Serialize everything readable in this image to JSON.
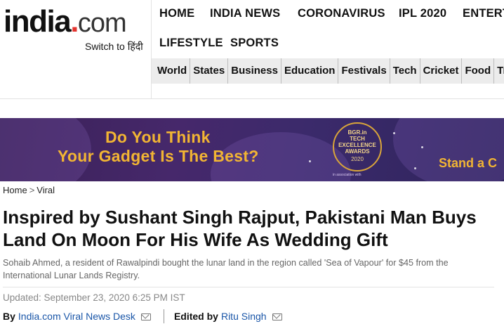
{
  "header": {
    "logo": {
      "main": "india",
      "dot": ".",
      "suffix": "com"
    },
    "switch_text": "Switch to हिंदी",
    "nav_row1": [
      "HOME",
      "INDIA NEWS",
      "CORONAVIRUS",
      "IPL 2020",
      "ENTERT"
    ],
    "nav_row2": [
      "LIFESTYLE",
      "SPORTS"
    ],
    "subnav": [
      "World",
      "States",
      "Business",
      "Education",
      "Festivals",
      "Tech",
      "Cricket",
      "Food",
      "Tra"
    ]
  },
  "banner": {
    "line1": "Do You Think",
    "line2": "Your Gadget Is The Best?",
    "badge": {
      "brand": "BGR.in",
      "line1": "TECH",
      "line2": "EXCELLENCE",
      "line3": "AWARDS",
      "year": "2020"
    },
    "association": "in association with",
    "cta": "Stand a C",
    "colors": {
      "accent": "#f2b533",
      "background": "#3a2157"
    }
  },
  "breadcrumb": {
    "home": "Home",
    "separator": ">",
    "section": "Viral"
  },
  "article": {
    "title": "Inspired by Sushant Singh Rajput, Pakistani Man Buys Land On Moon For His Wife As Wedding Gift",
    "summary": "Sohaib Ahmed, a resident of Rawalpindi bought the lunar land in the region called 'Sea of Vapour' for $45 from the International Lunar Lands Registry.",
    "updated": "Updated: September 23, 2020 6:25 PM IST",
    "by_label": "By",
    "author": "India.com Viral News Desk",
    "edited_label": "Edited by",
    "editor": "Ritu Singh",
    "author_color": "#1a56a8"
  }
}
